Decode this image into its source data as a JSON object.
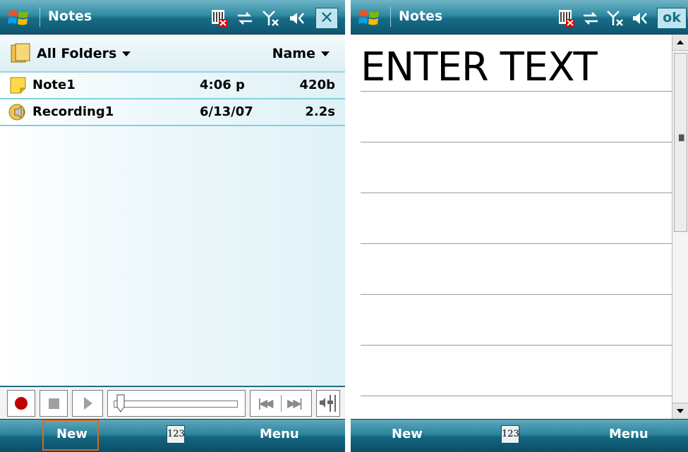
{
  "left": {
    "title": "Notes",
    "folder_label": "All Folders",
    "sort_label": "Name",
    "rows": [
      {
        "name": "Note1",
        "date": "4:06 p",
        "size": "420b",
        "icon": "note-icon"
      },
      {
        "name": "Recording1",
        "date": "6/13/07",
        "size": "2.2s",
        "icon": "audio-icon"
      }
    ],
    "softkeys": {
      "left": "New",
      "center": "123",
      "right": "Menu"
    },
    "close_label": "✕"
  },
  "right": {
    "title": "Notes",
    "ok_label": "ok",
    "content": "ENTER TEXT",
    "softkeys": {
      "left": "New",
      "center": "123",
      "right": "Menu"
    }
  },
  "colors": {
    "titlebar": "#1f7a94",
    "selection_border": "#d86a1a",
    "row_divider": "#82cfe0",
    "record_red": "#c00000"
  }
}
